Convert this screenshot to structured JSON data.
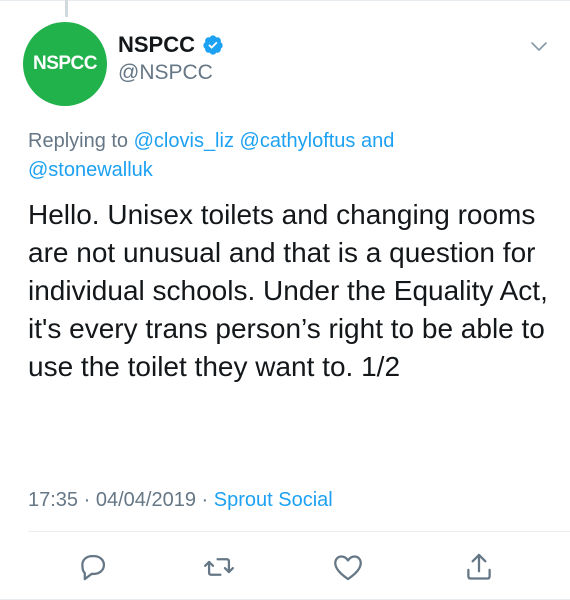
{
  "tweet": {
    "author": {
      "avatar_text": "NSPCC",
      "display_name": "NSPCC",
      "handle": "@NSPCC",
      "verified_icon": "verified-badge-icon"
    },
    "replying": {
      "prefix": "Replying to",
      "mentions": [
        "@clovis_liz",
        "@cathyloftus"
      ],
      "joiner": "and",
      "last_mention": "@stonewalluk"
    },
    "text": "Hello. Unisex toilets and changing rooms are not unusual and that is a question for individual schools. Under the Equality Act, it's every trans person’s right to be able to use the toilet they want to. 1/2",
    "time": "17:35",
    "separator1": "·",
    "date": "04/04/2019",
    "separator2": "·",
    "source": "Sprout Social"
  },
  "actions": [
    {
      "name": "reply",
      "icon": "reply-icon"
    },
    {
      "name": "retweet",
      "icon": "retweet-icon"
    },
    {
      "name": "like",
      "icon": "heart-icon"
    },
    {
      "name": "share",
      "icon": "share-icon"
    }
  ],
  "colors": {
    "brand_green": "#22b24c",
    "link_blue": "#1da1f2",
    "secondary_text": "#657786"
  }
}
